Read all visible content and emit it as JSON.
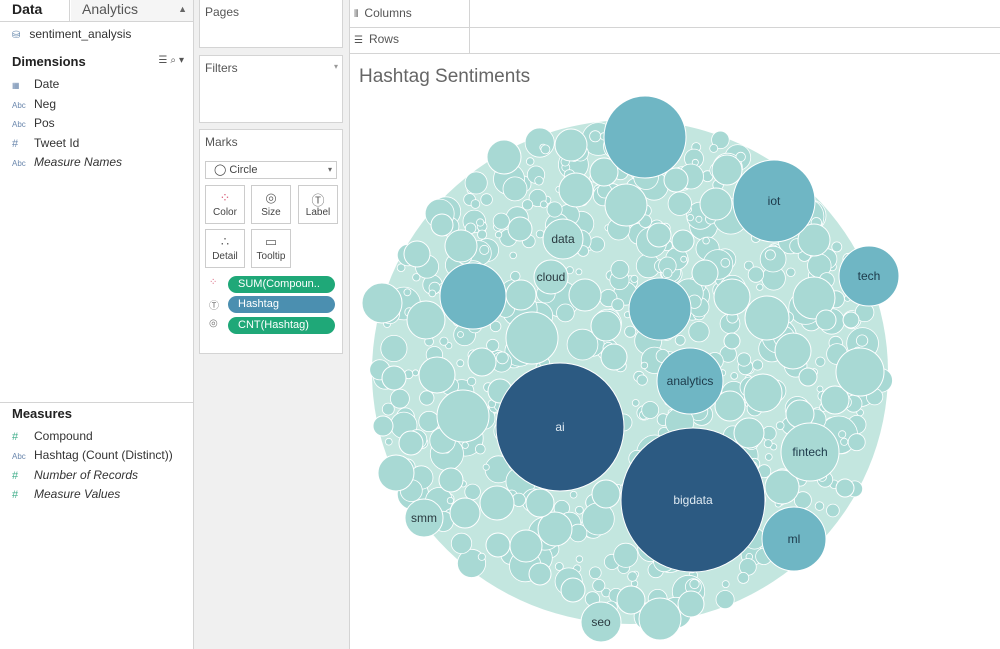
{
  "tabs": {
    "data": "Data",
    "analytics": "Analytics"
  },
  "datasource": "sentiment_analysis",
  "dimensions": {
    "title": "Dimensions",
    "items": [
      {
        "icon": "date",
        "label": "Date"
      },
      {
        "icon": "Abc",
        "label": "Neg"
      },
      {
        "icon": "Abc",
        "label": "Pos"
      },
      {
        "icon": "#",
        "label": "Tweet Id"
      },
      {
        "icon": "Abc",
        "label": "Measure Names"
      }
    ]
  },
  "measures": {
    "title": "Measures",
    "items": [
      {
        "icon": "#",
        "label": "Compound"
      },
      {
        "icon": "Abc",
        "label": "Hashtag (Count (Distinct))"
      },
      {
        "icon": "#",
        "label": "Number of Records"
      },
      {
        "icon": "#",
        "label": "Measure Values"
      }
    ]
  },
  "shelves": {
    "pages": "Pages",
    "filters": "Filters",
    "marks": "Marks",
    "columns": "Columns",
    "rows": "Rows"
  },
  "marks": {
    "type": "Circle",
    "buttons": {
      "color": "Color",
      "size": "Size",
      "label": "Label",
      "detail": "Detail",
      "tooltip": "Tooltip"
    },
    "pills": [
      {
        "icon": "color-dots",
        "label": "SUM(Compoun..",
        "color": "#1fa878"
      },
      {
        "icon": "label-box",
        "label": "Hashtag",
        "color": "#4b8fb0"
      },
      {
        "icon": "size-circle",
        "label": "CNT(Hashtag)",
        "color": "#1fa878"
      }
    ]
  },
  "viz": {
    "title": "Hashtag Sentiments",
    "colors": {
      "darkest": "#2c5a82",
      "mid": "#6fb6c4",
      "light": "#a8d9d4",
      "faint": "#c3e6df"
    },
    "labels": [
      "iot",
      "data",
      "cloud",
      "tech",
      "analytics",
      "ai",
      "fintech",
      "bigdata",
      "ml",
      "smm",
      "seo"
    ]
  }
}
